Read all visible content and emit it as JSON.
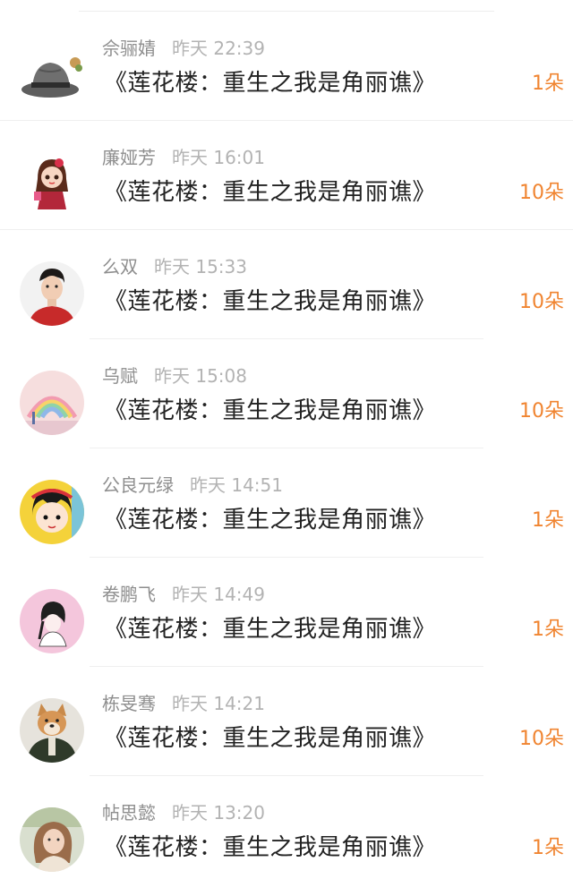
{
  "accent_color": "#f08430",
  "entries": [
    {
      "name": "佘骊婧",
      "time": "昨天 22:39",
      "title": "《莲花楼：重生之我是角丽谯》",
      "amount": "1朵",
      "avatar": "gray-fedora-hat-avatar"
    },
    {
      "name": "廉娅芳",
      "time": "昨天 16:01",
      "title": "《莲花楼：重生之我是角丽谯》",
      "amount": "10朵",
      "avatar": "cartoon-girl-avatar"
    },
    {
      "name": "么双",
      "time": "昨天 15:33",
      "title": "《莲花楼：重生之我是角丽谯》",
      "amount": "10朵",
      "avatar": "young-man-red-shirt-avatar"
    },
    {
      "name": "乌赋",
      "time": "昨天 15:08",
      "title": "《莲花楼：重生之我是角丽谯》",
      "amount": "10朵",
      "avatar": "rainbow-avatar"
    },
    {
      "name": "公良元绿",
      "time": "昨天 14:51",
      "title": "《莲花楼：重生之我是角丽谯》",
      "amount": "1朵",
      "avatar": "cartoon-child-avatar"
    },
    {
      "name": "卷鹏飞",
      "time": "昨天 14:49",
      "title": "《莲花楼：重生之我是角丽谯》",
      "amount": "1朵",
      "avatar": "pink-sketch-girl-avatar"
    },
    {
      "name": "栋旻骞",
      "time": "昨天 14:21",
      "title": "《莲花楼：重生之我是角丽谯》",
      "amount": "10朵",
      "avatar": "shiba-dog-avatar"
    },
    {
      "name": "帖思懿",
      "time": "昨天 13:20",
      "title": "《莲花楼：重生之我是角丽谯》",
      "amount": "1朵",
      "avatar": "girl-portrait-avatar"
    }
  ]
}
